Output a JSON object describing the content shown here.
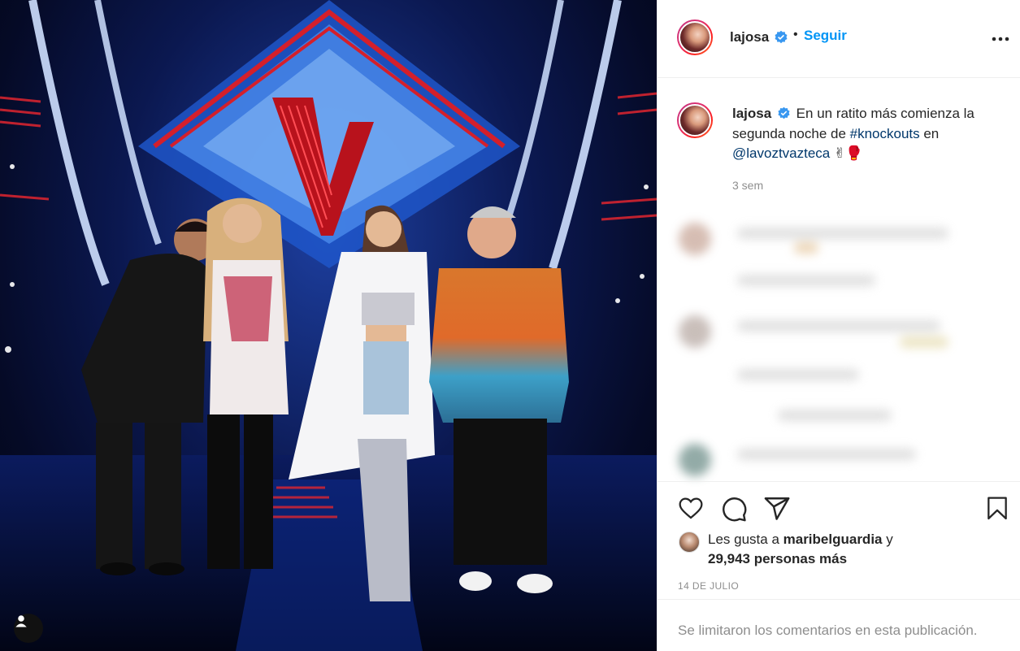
{
  "post": {
    "photo_alt": "Judges on The Voice stage",
    "user_tags_icon": "user-icon"
  },
  "header": {
    "username": "lajosa",
    "dot": "•",
    "follow_label": "Seguir",
    "more_icon": "more-horizontal-icon",
    "verified_icon": "verified-badge-icon"
  },
  "caption": {
    "username": "lajosa",
    "text_before": "En un ratito más comienza la segunda noche de ",
    "hashtag": "#knockouts",
    "text_middle": " en ",
    "mention": "@lavoztvazteca",
    "emoji": "✌🥊",
    "time": "3 sem"
  },
  "actions": {
    "like_icon": "heart-icon",
    "comment_icon": "comment-icon",
    "share_icon": "share-icon",
    "save_icon": "bookmark-icon"
  },
  "likes": {
    "prefix": "Les gusta a ",
    "liker": "maribelguardia",
    "suffix": " y",
    "others": "29,943 personas más"
  },
  "date": "14 DE JULIO",
  "footer_text": "Se limitaron los comentarios en esta publicación.",
  "colors": {
    "link_blue": "#0095f6",
    "hashtag": "#00376b",
    "muted": "#8e8e8e"
  }
}
